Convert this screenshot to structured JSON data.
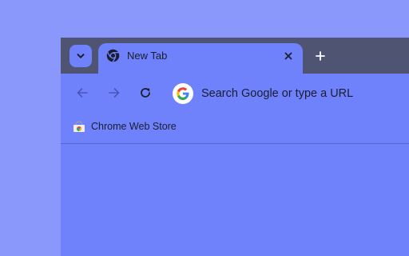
{
  "tabstrip": {
    "tab_search_icon": "chevron-down-icon",
    "tabs": [
      {
        "title": "New Tab",
        "favicon": "chrome-icon",
        "active": true
      }
    ],
    "close_icon": "close-icon",
    "new_tab_icon": "plus-icon"
  },
  "toolbar": {
    "back_icon": "arrow-left-icon",
    "forward_icon": "arrow-right-icon",
    "reload_icon": "reload-icon",
    "omnibox": {
      "icon": "google-g-icon",
      "placeholder": "Search Google or type a URL"
    }
  },
  "bookmarks_bar": {
    "items": [
      {
        "label": "Chrome Web Store",
        "icon": "chrome-web-store-icon"
      }
    ]
  },
  "colors": {
    "desktop_bg": "#8a98fb",
    "tabstrip_bg": "#4f5472",
    "toolbar_bg": "#6f82fb",
    "text": "#1b1e2e"
  }
}
